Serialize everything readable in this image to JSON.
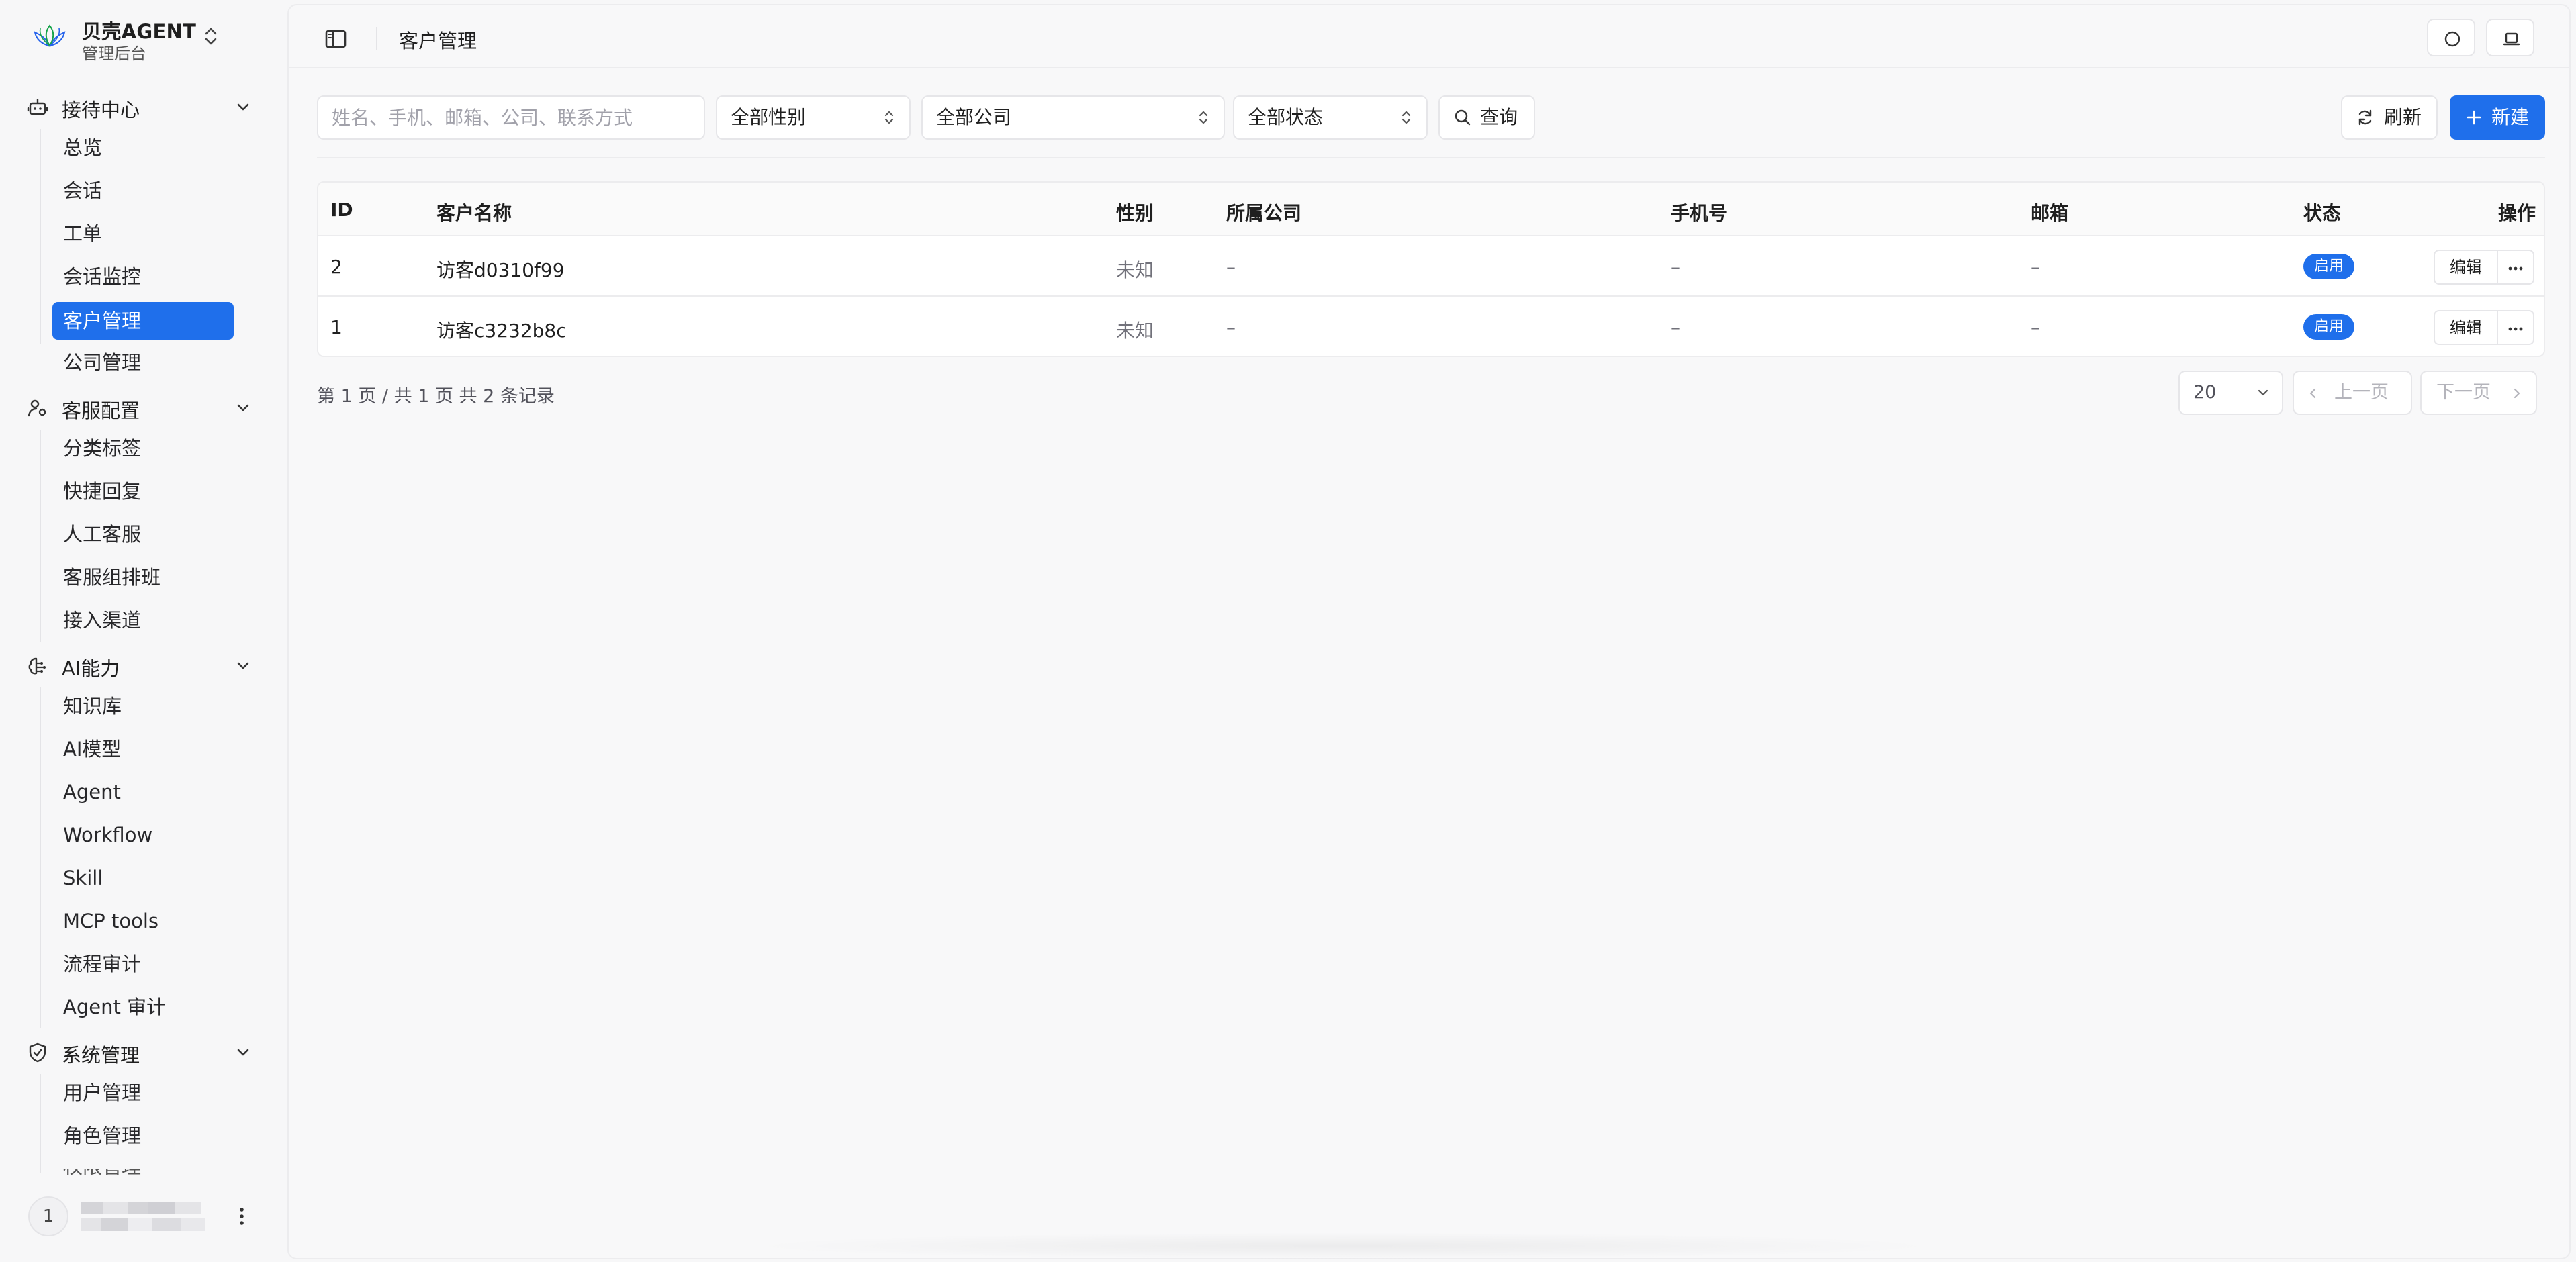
{
  "brand": {
    "title": "贝壳AGENT",
    "subtitle": "管理后台"
  },
  "sidebar": {
    "groups": [
      {
        "label": "接待中心",
        "icon": "robot-icon",
        "items": [
          "总览",
          "会话",
          "工单",
          "会话监控",
          "客户管理",
          "公司管理"
        ]
      },
      {
        "label": "客服配置",
        "icon": "user-settings-icon",
        "items": [
          "分类标签",
          "快捷回复",
          "人工客服",
          "客服组排班",
          "接入渠道"
        ]
      },
      {
        "label": "AI能力",
        "icon": "brain-icon",
        "items": [
          "知识库",
          "AI模型",
          "Agent",
          "Workflow",
          "Skill",
          "MCP tools",
          "流程审计",
          "Agent 审计"
        ]
      },
      {
        "label": "系统管理",
        "icon": "shield-icon",
        "items": [
          "用户管理",
          "角色管理",
          "权限管理"
        ]
      }
    ],
    "active_item": "客户管理",
    "user": {
      "avatar_text": "1"
    }
  },
  "header": {
    "page_title": "客户管理"
  },
  "filters": {
    "search_placeholder": "姓名、手机、邮箱、公司、联系方式",
    "gender": "全部性别",
    "company": "全部公司",
    "status": "全部状态",
    "query_label": "查询",
    "refresh_label": "刷新",
    "new_label": "新建"
  },
  "table": {
    "columns": [
      "ID",
      "客户名称",
      "性别",
      "所属公司",
      "手机号",
      "邮箱",
      "状态",
      "操作"
    ],
    "rows": [
      {
        "id": "2",
        "name": "访客d0310f99",
        "gender": "未知",
        "company": "–",
        "phone": "–",
        "email": "–",
        "status": "启用",
        "edit": "编辑"
      },
      {
        "id": "1",
        "name": "访客c3232b8c",
        "gender": "未知",
        "company": "–",
        "phone": "–",
        "email": "–",
        "status": "启用",
        "edit": "编辑"
      }
    ]
  },
  "pagination": {
    "info": "第 1 页 / 共 1 页   共 2 条记录",
    "page_size": "20",
    "prev_label": "上一页",
    "next_label": "下一页"
  },
  "colors": {
    "accent": "#1f6feb",
    "background": "#f7f7f8"
  }
}
